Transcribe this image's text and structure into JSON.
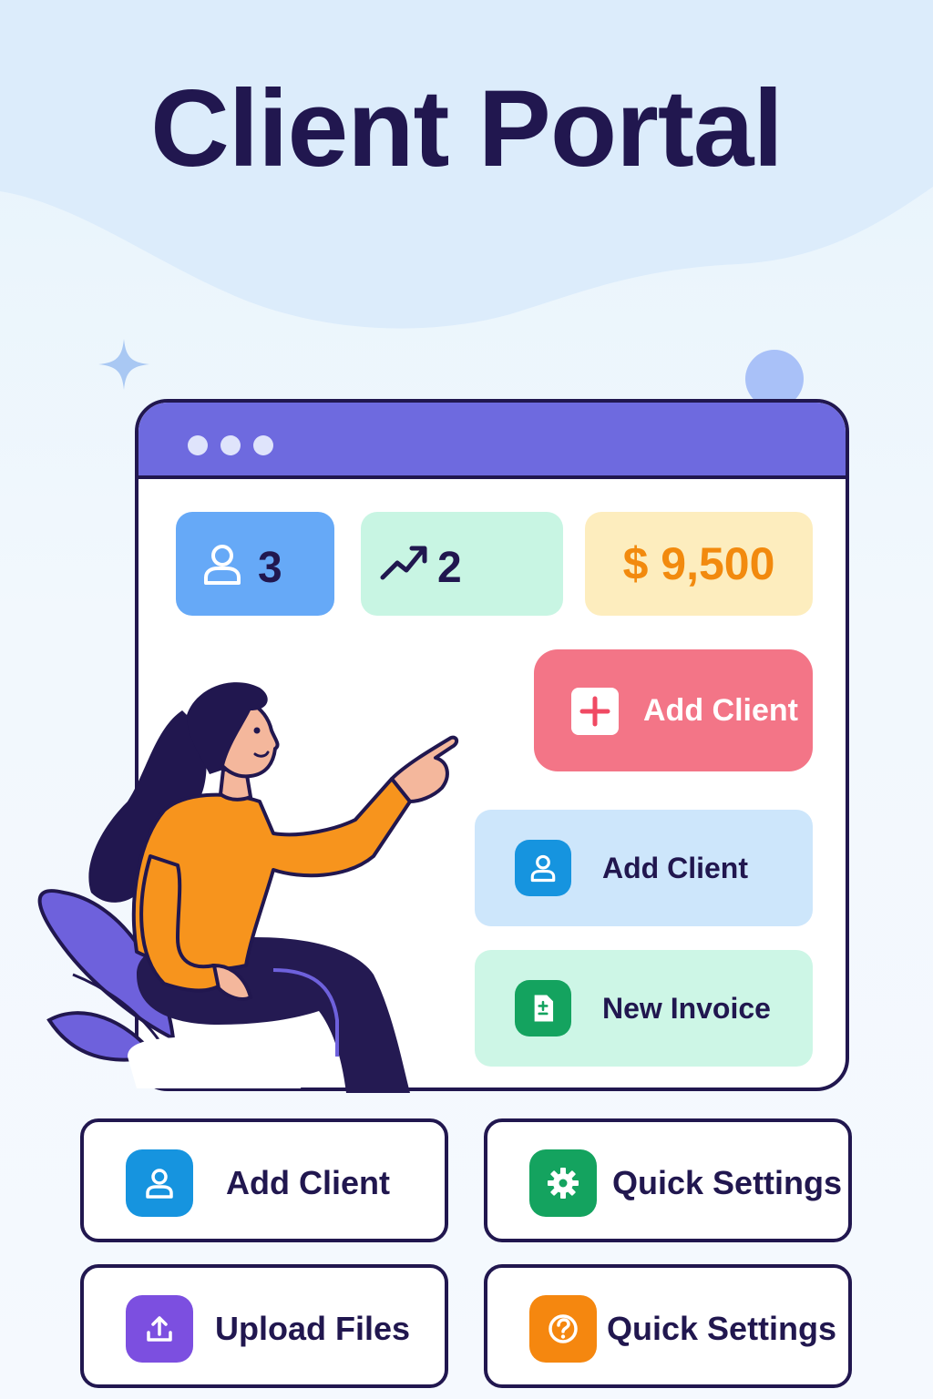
{
  "title": "Client Portal",
  "stats": {
    "clients": "3",
    "growth": "2",
    "revenue": "$ 9,500"
  },
  "buttons": {
    "primary_add_client": "Add Client",
    "add_client": "Add Client",
    "new_invoice": "New Invoice"
  },
  "actions": [
    {
      "label": "Add Client",
      "icon": "user-icon",
      "color": "#1694df"
    },
    {
      "label": "Quick Settings",
      "icon": "gear-icon",
      "color": "#14a35f"
    },
    {
      "label": "Upload Files",
      "icon": "upload-icon",
      "color": "#7c4fe0"
    },
    {
      "label": "Quick Settings",
      "icon": "help-icon",
      "color": "#f5870f"
    }
  ],
  "colors": {
    "ink": "#21174f",
    "titlebar": "#6e6adf",
    "primary_button": "#f37587",
    "revenue_text": "#f28a0e"
  }
}
